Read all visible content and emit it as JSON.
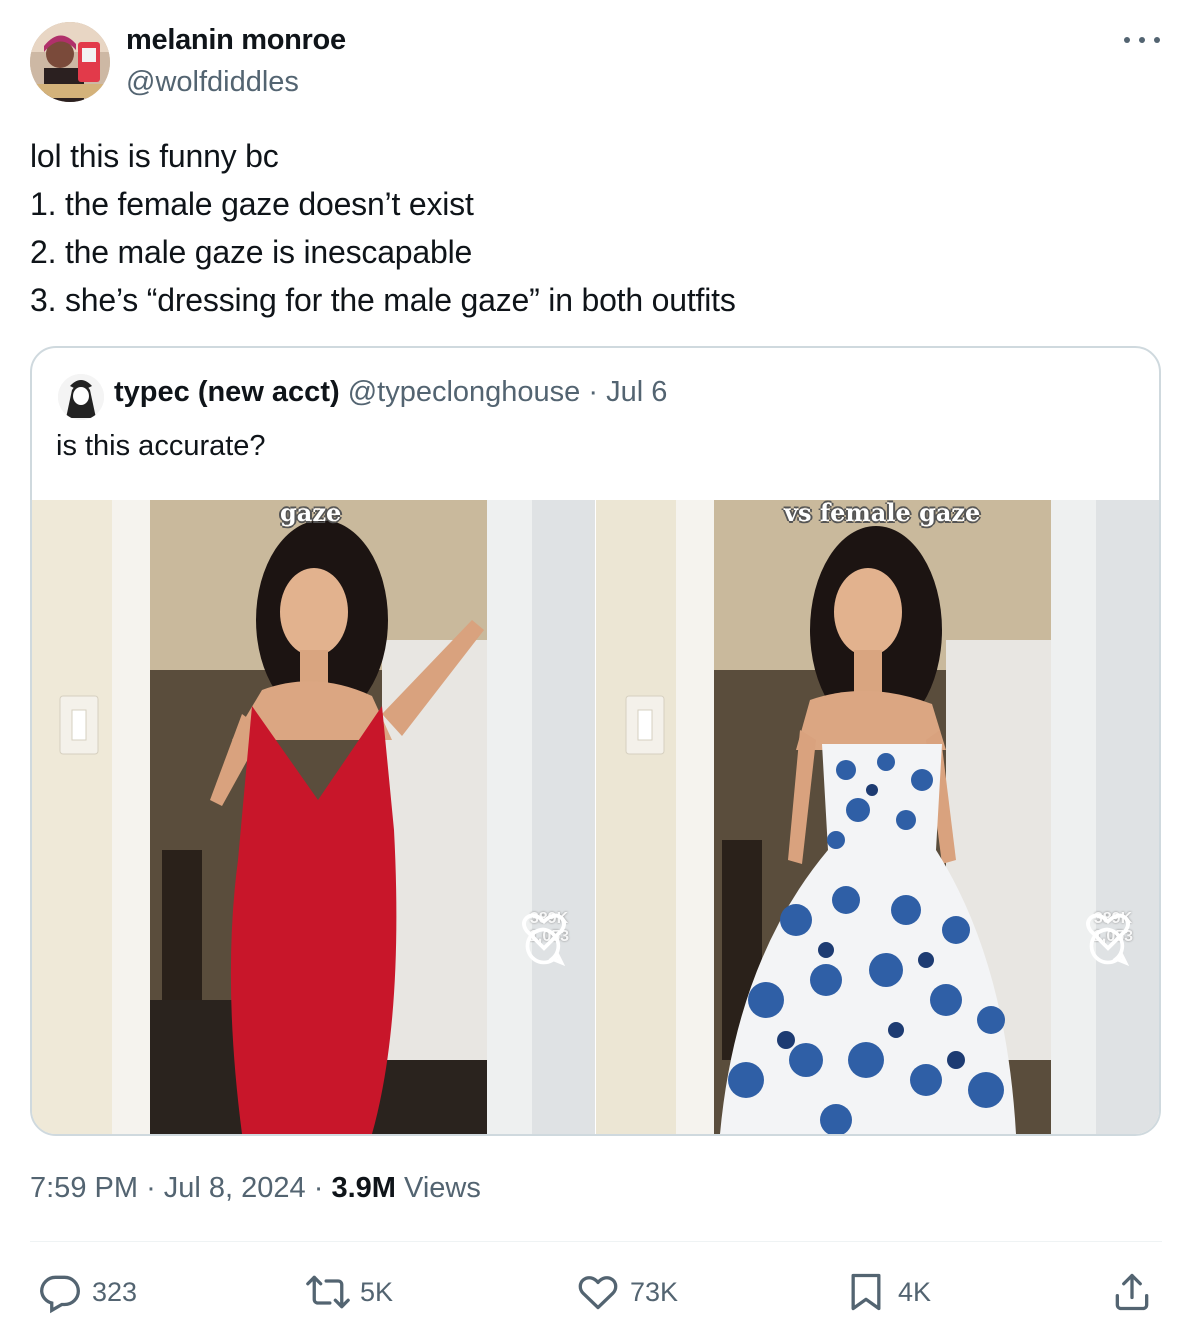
{
  "author": {
    "name": "melanin monroe",
    "handle": "@wolfdiddles"
  },
  "tweet": {
    "lines": [
      "lol this is funny bc",
      "1. the female gaze doesn’t exist",
      "2. the male gaze is inescapable",
      "3. she’s “dressing for the male gaze” in both outfits"
    ]
  },
  "quote": {
    "name": "typec (new acct)",
    "handle": "@typeclonghouse",
    "separator": "·",
    "date": "Jul 6",
    "text": "is this accurate?",
    "images": [
      {
        "caption": "gaze",
        "likes": "389K",
        "comments": "1,053",
        "dress_color": "#c8162a"
      },
      {
        "caption": "vs female gaze",
        "likes": "389K",
        "comments": "1,053",
        "dress_color": "#2f5fa6"
      }
    ]
  },
  "meta": {
    "time": "7:59 PM",
    "dot": "·",
    "date": "Jul 8, 2024",
    "views_count": "3.9M",
    "views_label": "Views"
  },
  "actions": {
    "replies": "323",
    "reposts": "5K",
    "likes": "73K",
    "bookmarks": "4K"
  },
  "colors": {
    "text": "#0f1419",
    "secondary": "#536471",
    "border": "#cfd9de"
  }
}
